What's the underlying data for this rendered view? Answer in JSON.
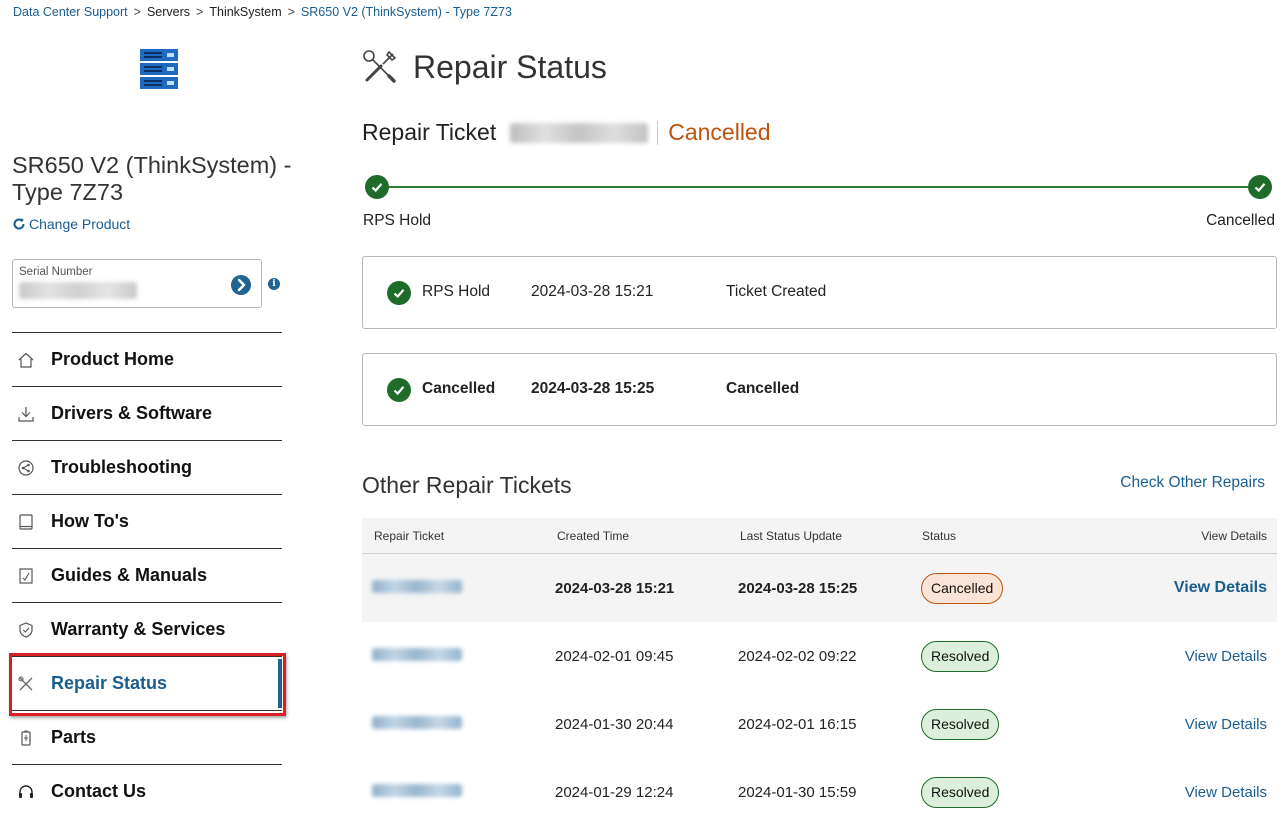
{
  "breadcrumb": [
    {
      "label": "Data Center Support",
      "link": true
    },
    {
      "label": "Servers",
      "link": false
    },
    {
      "label": "ThinkSystem",
      "link": false
    },
    {
      "label": "SR650 V2 (ThinkSystem) - Type 7Z73",
      "link": true
    }
  ],
  "sidebar": {
    "product_title": "SR650 V2 (ThinkSystem) - Type 7Z73",
    "change_product": "Change Product",
    "serial_label": "Serial Number",
    "nav": [
      {
        "label": "Product Home",
        "icon": "home-icon"
      },
      {
        "label": "Drivers & Software",
        "icon": "download-icon"
      },
      {
        "label": "Troubleshooting",
        "icon": "share-icon"
      },
      {
        "label": "How To's",
        "icon": "book-icon"
      },
      {
        "label": "Guides & Manuals",
        "icon": "manual-icon"
      },
      {
        "label": "Warranty & Services",
        "icon": "shield-icon"
      },
      {
        "label": "Repair Status",
        "icon": "tools-icon",
        "active": true
      },
      {
        "label": "Parts",
        "icon": "battery-icon"
      },
      {
        "label": "Contact Us",
        "icon": "headset-icon"
      }
    ]
  },
  "main": {
    "title": "Repair Status",
    "ticket_label": "Repair Ticket",
    "ticket_status": "Cancelled",
    "progress": {
      "start_label": "RPS Hold",
      "end_label": "Cancelled"
    },
    "events": [
      {
        "status": "RPS Hold",
        "time": "2024-03-28 15:21",
        "description": "Ticket Created"
      },
      {
        "status": "Cancelled",
        "time": "2024-03-28 15:25",
        "description": "Cancelled"
      }
    ],
    "other_title": "Other Repair Tickets",
    "check_other": "Check Other Repairs",
    "table": {
      "headers": [
        "Repair Ticket",
        "Created Time",
        "Last Status Update",
        "Status",
        "View Details"
      ],
      "rows": [
        {
          "created": "2024-03-28 15:21",
          "updated": "2024-03-28 15:25",
          "status": "Cancelled",
          "view": "View Details"
        },
        {
          "created": "2024-02-01 09:45",
          "updated": "2024-02-02 09:22",
          "status": "Resolved",
          "view": "View Details"
        },
        {
          "created": "2024-01-30 20:44",
          "updated": "2024-02-01 16:15",
          "status": "Resolved",
          "view": "View Details"
        },
        {
          "created": "2024-01-29 12:24",
          "updated": "2024-01-30 15:59",
          "status": "Resolved",
          "view": "View Details"
        }
      ]
    }
  },
  "colors": {
    "link": "#1a5d8f",
    "success": "#1e6b2a",
    "cancelled": "#c0530c",
    "highlight_border": "#d62024"
  }
}
